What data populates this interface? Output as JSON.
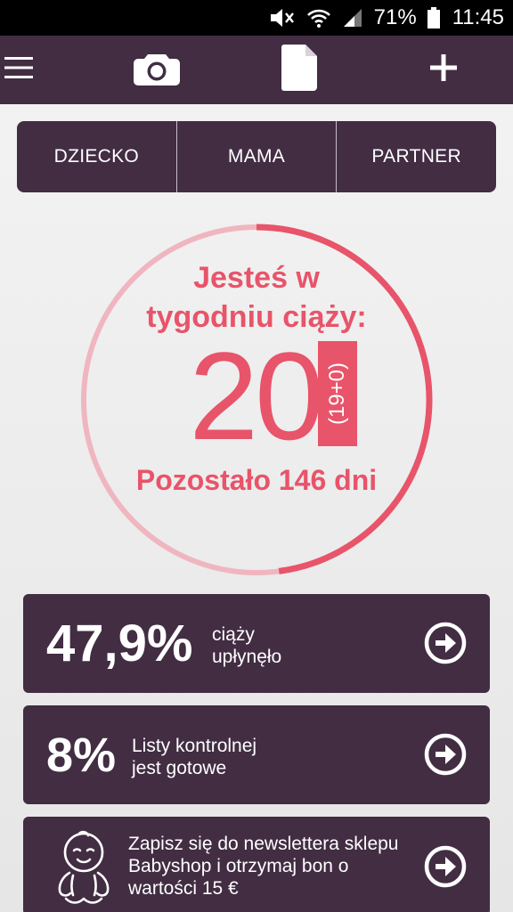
{
  "status_bar": {
    "battery": "71%",
    "time": "11:45",
    "icons": [
      "mute-icon",
      "wifi-icon",
      "signal-icon",
      "battery-icon"
    ]
  },
  "toolbar": {
    "icons": [
      "menu-icon",
      "camera-icon",
      "document-icon",
      "plus-icon"
    ]
  },
  "segments": [
    "DZIECKO",
    "MAMA",
    "PARTNER"
  ],
  "progress": {
    "title_line1": "Jesteś w",
    "title_line2": "tygodniu ciąży:",
    "week": "20",
    "week_detail": "(19+0)",
    "remaining": "Pozostało 146 dni",
    "percent_elapsed": 47.9
  },
  "cards": [
    {
      "value": "47,9%",
      "line1": "ciąży",
      "line2": "upłynęło"
    },
    {
      "value": "8%",
      "line1": "Listy kontrolnej",
      "line2": "jest gotowe"
    },
    {
      "line1": "Zapisz się do newslettera sklepu",
      "line2": "Babyshop i otrzymaj bon o",
      "line3": "wartości 15 €"
    }
  ],
  "colors": {
    "primary_dark": "#422d43",
    "accent_pink": "#e8546a",
    "ring_light": "#f0b6c0"
  }
}
